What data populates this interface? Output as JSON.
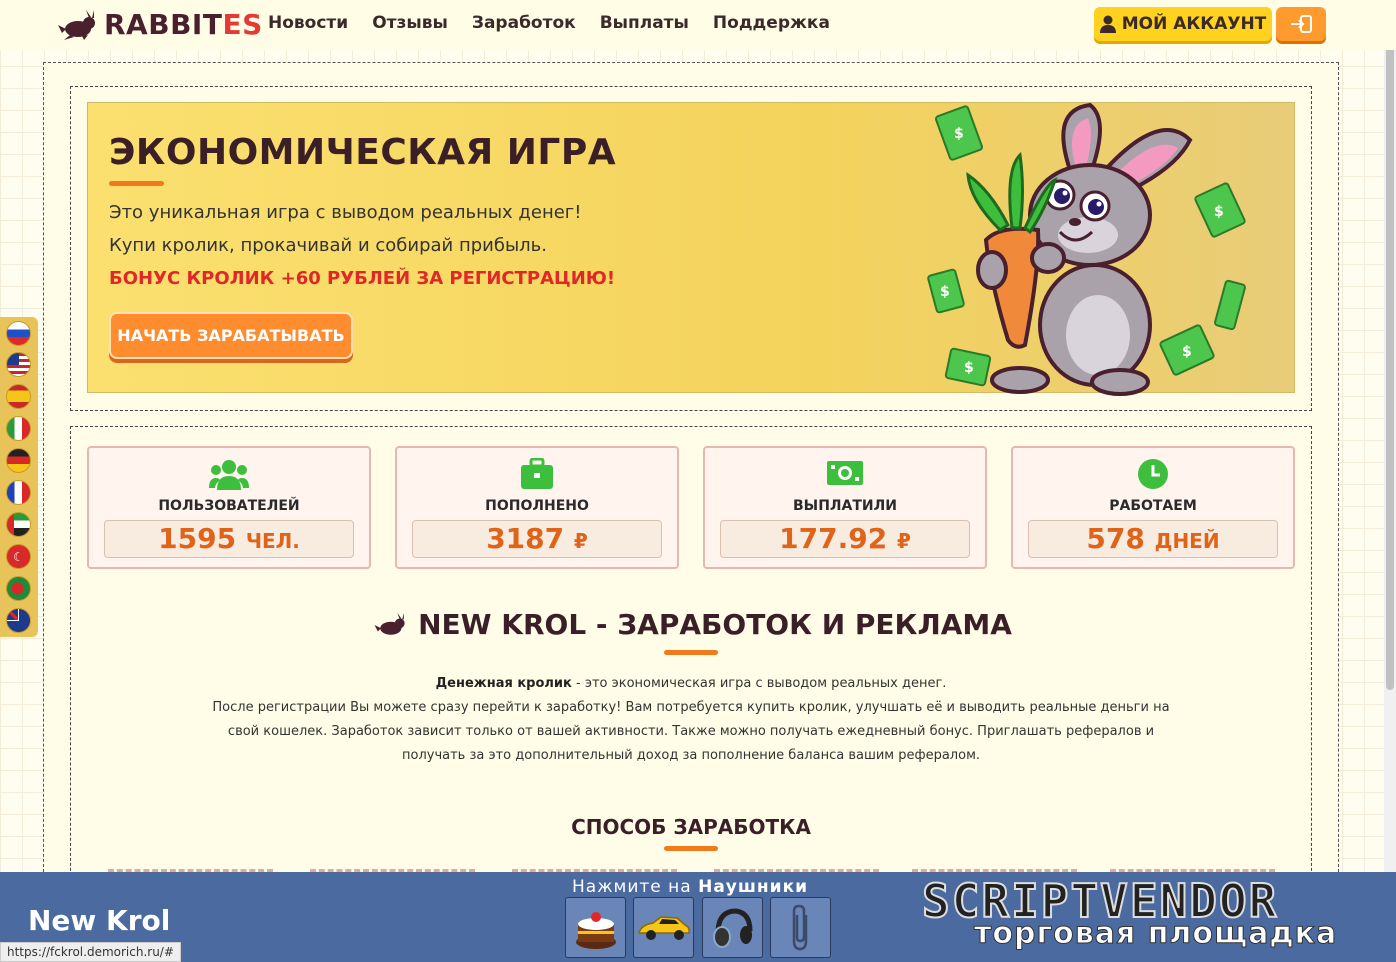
{
  "header": {
    "logo_main": "RABBIT",
    "logo_accent": "ES",
    "nav": [
      "Новости",
      "Отзывы",
      "Заработок",
      "Выплаты",
      "Поддержка"
    ],
    "account_label": "МОЙ АККАУНТ"
  },
  "hero": {
    "title": "ЭКОНОМИЧЕСКАЯ ИГРА",
    "line1": "Это уникальная игра с выводом реальных денег!",
    "line2": "Купи кролик, прокачивай и собирай прибыль.",
    "bonus": "БОНУС КРОЛИК +60 РУБЛЕЙ ЗА РЕГИСТРАЦИЮ!",
    "cta": "НАЧАТЬ ЗАРАБАТЫВАТЬ"
  },
  "stats": [
    {
      "label": "ПОЛЬЗОВАТЕЛЕЙ",
      "value": "1595",
      "unit": "ЧЕЛ.",
      "icon": "users-icon"
    },
    {
      "label": "ПОПОЛНЕНО",
      "value": "3187",
      "unit": "₽",
      "icon": "briefcase-icon"
    },
    {
      "label": "ВЫПЛАТИЛИ",
      "value": "177.92",
      "unit": "₽",
      "icon": "money-icon"
    },
    {
      "label": "РАБОТАЕМ",
      "value": "578",
      "unit": "ДНЕЙ",
      "icon": "clock-icon"
    }
  ],
  "about": {
    "title": "NEW KROL - ЗАРАБОТОК И РЕКЛАМА",
    "bold": "Денежная кролик",
    "intro": " - это экономическая игра с выводом реальных денег.",
    "body": "После регистрации Вы можете сразу перейти к заработку! Вам потребуется купить кролик, улучшать её и выводить реальные деньги на свой кошелек. Заработок зависит только от вашей активности. Также можно получать ежедневный бонус. Приглашать рефералов и получать за это дополнительный доход за пополнение баланса вашим рефералом.",
    "method_title": "СПОСОБ ЗАРАБОТКА"
  },
  "colors": {
    "accent": "#f07a1a",
    "hero_bg": "#f4d35c",
    "bonus": "#e02828",
    "stat_value": "#e0631a",
    "icon_green": "#3dbf3d"
  },
  "bottom": {
    "brand": "New Krol",
    "url": "https://fckrol.demorich.ru/#",
    "hint_prefix": "Нажмите на",
    "hint_target": "Наушники",
    "vendor_top": "SCRIPTVENDOR",
    "vendor_bottom": "торговая площадка"
  }
}
